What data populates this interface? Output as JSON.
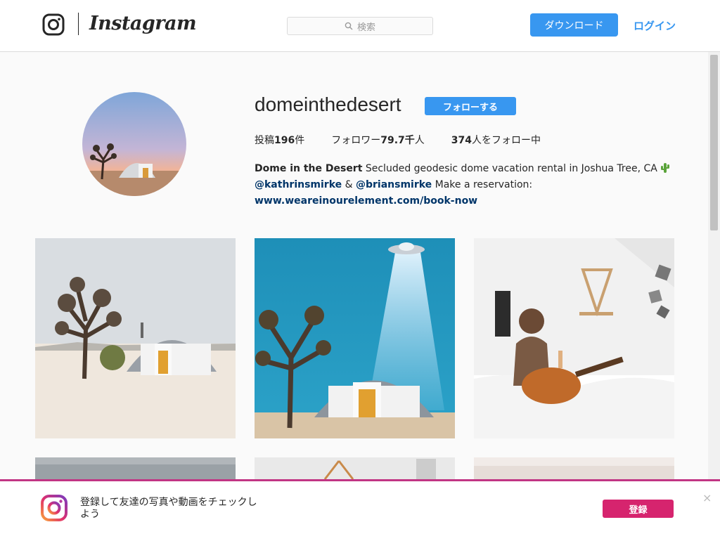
{
  "header": {
    "brand": "Instagram",
    "search_placeholder": "検索",
    "download_label": "ダウンロード",
    "login_label": "ログイン"
  },
  "profile": {
    "username": "domeinthedesert",
    "follow_label": "フォローする",
    "stats": {
      "posts_prefix": "投稿",
      "posts_count": "196",
      "posts_suffix": "件",
      "followers_prefix": "フォロワー",
      "followers_count": "79.7千",
      "followers_suffix": "人",
      "following_count": "374",
      "following_suffix": "人をフォロー中"
    },
    "bio": {
      "display_name": "Dome in the Desert",
      "text_line1": "Secluded geodesic dome vacation rental in Joshua Tree, CA",
      "mention1": "@kathrinsmirke",
      "amp": "&",
      "mention2": "@briansmirke",
      "text_line2": "Make a reservation:",
      "link": "www.weareinourelement.com/book-now"
    }
  },
  "banner": {
    "text": "登録して友達の写真や動画をチェックしよう",
    "signup_label": "登録",
    "close_glyph": "×"
  },
  "colors": {
    "accent": "#3897f0",
    "signup": "#d6246e",
    "link": "#003569"
  },
  "icons": [
    "instagram-logo-icon",
    "search-icon",
    "cactus-icon",
    "close-icon"
  ]
}
